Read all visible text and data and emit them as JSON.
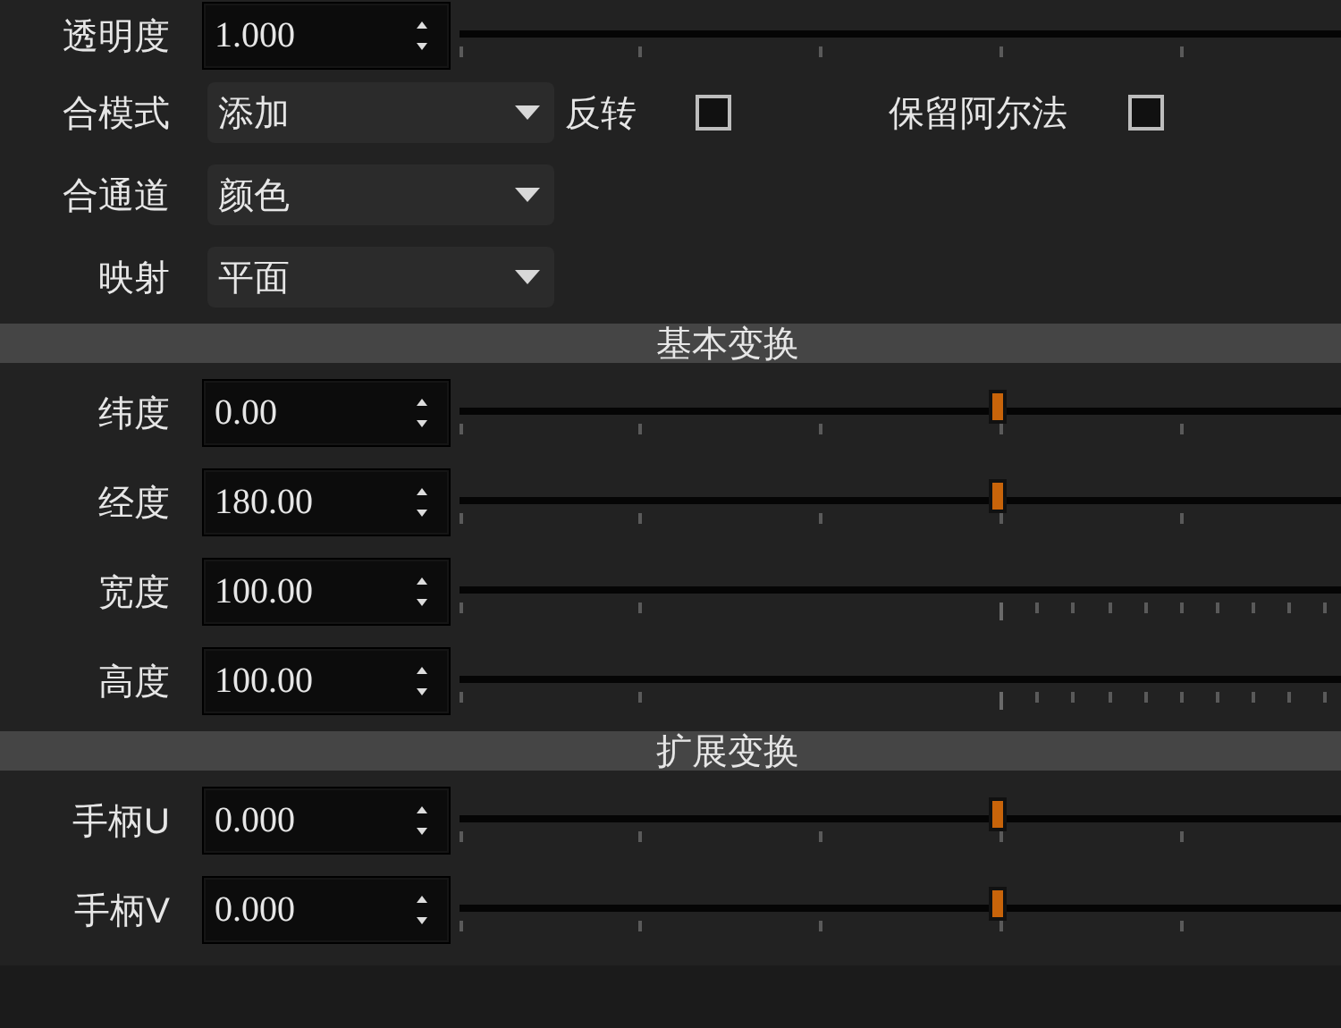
{
  "rows": [
    {
      "kind": "spin",
      "label": "透明度",
      "value": "1.000",
      "slider": {
        "kind": "coarse"
      }
    },
    {
      "kind": "select",
      "label": "合模式",
      "value": "添加",
      "checks": [
        {
          "label": "反转",
          "checked": false
        },
        {
          "label": "保留阿尔法",
          "checked": false
        }
      ]
    },
    {
      "kind": "select",
      "label": "合通道",
      "value": "颜色"
    },
    {
      "kind": "select",
      "label": "映射",
      "value": "平面"
    },
    {
      "kind": "header",
      "label": "基本变换"
    },
    {
      "kind": "spin",
      "label": "纬度",
      "value": "0.00",
      "slider": {
        "kind": "coarse",
        "level": 0.61
      }
    },
    {
      "kind": "spin",
      "label": "经度",
      "value": "180.00",
      "slider": {
        "kind": "coarse",
        "level": 0.61
      }
    },
    {
      "kind": "spin",
      "label": "宽度",
      "value": "100.00",
      "slider": {
        "kind": "fine"
      }
    },
    {
      "kind": "spin",
      "label": "高度",
      "value": "100.00",
      "slider": {
        "kind": "fine"
      }
    },
    {
      "kind": "header",
      "label": "扩展变换"
    },
    {
      "kind": "spin",
      "label": "手柄U",
      "value": "0.000",
      "slider": {
        "kind": "coarse",
        "level": 0.61
      }
    },
    {
      "kind": "spin",
      "label": "手柄V",
      "value": "0.000",
      "slider": {
        "kind": "coarse",
        "level": 0.61
      }
    }
  ]
}
